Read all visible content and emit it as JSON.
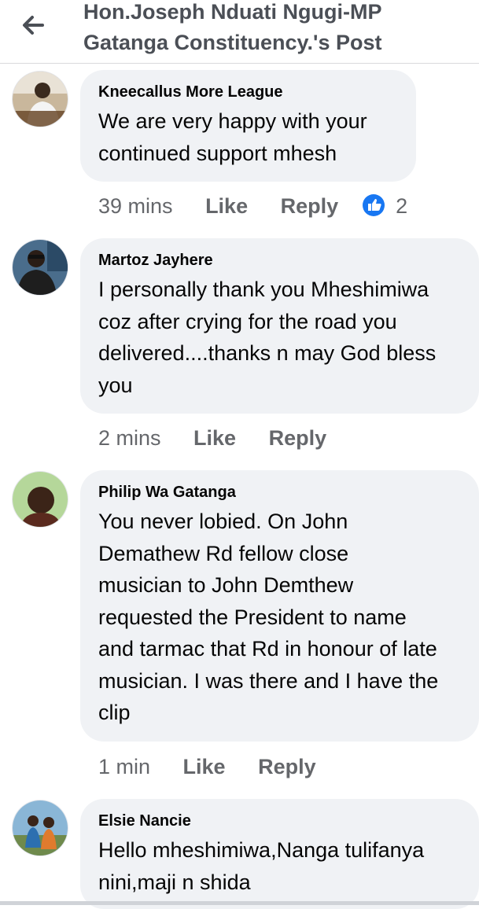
{
  "header": {
    "title_line1": "Hon.Joseph Nduati Ngugi-MP",
    "title_line2": "Gatanga Constituency.'s Post",
    "back_icon": "arrow-left-icon"
  },
  "colors": {
    "bubble": "#f0f2f5",
    "meta_text": "#65676b",
    "like_blue": "#1877f2",
    "header_text": "#4b4f56"
  },
  "comments": [
    {
      "author": "Kneecallus More League",
      "lines": [
        "We are very happy with your",
        "continued support mhesh"
      ],
      "time": "39 mins",
      "like": "Like",
      "reply": "Reply",
      "reaction_icon": "like-reaction-icon",
      "reaction_count": "2"
    },
    {
      "author": "Martoz Jayhere",
      "lines": [
        "I personally thank you Mheshimiwa",
        "coz after crying for the road you",
        "delivered....thanks n may God bless",
        "you"
      ],
      "time": "2 mins",
      "like": "Like",
      "reply": "Reply"
    },
    {
      "author": "Philip Wa Gatanga",
      "lines": [
        "You never lobied. On John",
        "Demathew Rd fellow close",
        "musician to John Demthew",
        "requested the President to name",
        "and tarmac that Rd in honour of late",
        "musician. I was there and I have the",
        "clip"
      ],
      "time": "1 min",
      "like": "Like",
      "reply": "Reply"
    },
    {
      "author": "Elsie Nancie",
      "lines": [
        "Hello mheshimiwa,Nanga tulifanya",
        "nini,maji n shida"
      ]
    }
  ]
}
